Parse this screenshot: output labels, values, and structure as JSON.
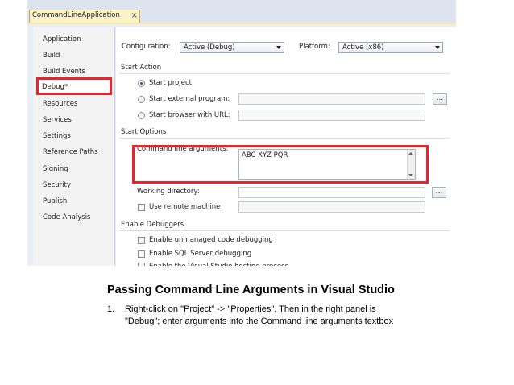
{
  "tab": {
    "title": "CommandLineApplication",
    "close": "×"
  },
  "sidebar": {
    "items": [
      {
        "label": "Application"
      },
      {
        "label": "Build"
      },
      {
        "label": "Build Events"
      },
      {
        "label": "Debug*"
      },
      {
        "label": "Resources"
      },
      {
        "label": "Services"
      },
      {
        "label": "Settings"
      },
      {
        "label": "Reference Paths"
      },
      {
        "label": "Signing"
      },
      {
        "label": "Security"
      },
      {
        "label": "Publish"
      },
      {
        "label": "Code Analysis"
      }
    ]
  },
  "config": {
    "configuration_label": "Configuration:",
    "configuration_value": "Active (Debug)",
    "platform_label": "Platform:",
    "platform_value": "Active (x86)"
  },
  "start_action": {
    "heading": "Start Action",
    "start_project": "Start project",
    "start_external": "Start external program:",
    "start_browser": "Start browser with URL:",
    "browse_label": "..."
  },
  "start_options": {
    "heading": "Start Options",
    "cmd_args_label": "Command line arguments:",
    "cmd_args_value": "ABC XYZ PQR",
    "working_dir_label": "Working directory:",
    "browse_label": "...",
    "remote_label": "Use remote machine"
  },
  "debuggers": {
    "heading": "Enable Debuggers",
    "unmanaged": "Enable unmanaged code debugging",
    "sql": "Enable SQL Server debugging",
    "hosting": "Enable the Visual Studio hosting process"
  },
  "caption": {
    "title": "Passing Command Line Arguments in Visual Studio",
    "step_number": "1.",
    "step_text": "Right-click on \"Project\" -> \"Properties\". Then in the right panel is \"Debug\"; enter arguments into the Command line arguments textbox"
  },
  "colors": {
    "highlight": "#e8252f",
    "tab_active": "#fbf2c8",
    "chrome": "#e9eef7"
  }
}
